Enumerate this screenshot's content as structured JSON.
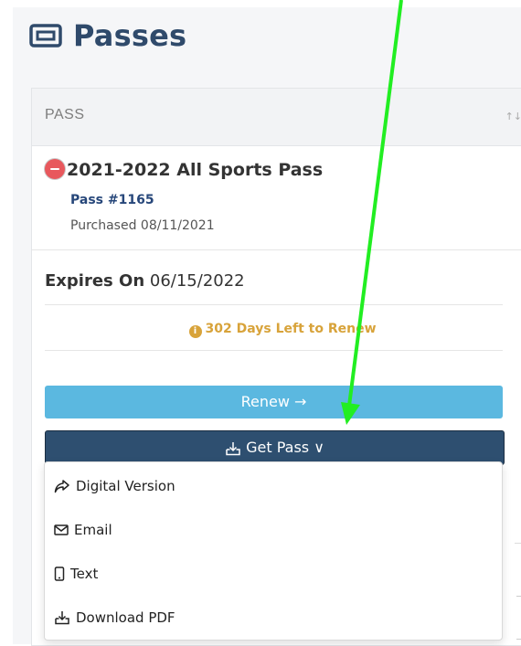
{
  "header": {
    "title": "Passes",
    "icon": "ticket-icon"
  },
  "table": {
    "column_label": "PASS",
    "sort_icon": "↑↓"
  },
  "pass": {
    "name": "2021-2022 All Sports Pass",
    "number": "Pass #1165",
    "purchased": "Purchased 08/11/2021",
    "expires_label": "Expires On",
    "expires_date": "06/15/2022",
    "days_left": "302 Days Left to Renew"
  },
  "buttons": {
    "renew": "Renew",
    "renew_arrow": "→",
    "get_pass": "Get Pass",
    "get_pass_chevron": "∨"
  },
  "dropdown": {
    "items": [
      {
        "label": "Digital Version",
        "icon": "share-icon"
      },
      {
        "label": "Email",
        "icon": "envelope-icon"
      },
      {
        "label": "Text",
        "icon": "phone-icon"
      },
      {
        "label": "Download PDF",
        "icon": "download-icon"
      }
    ]
  },
  "colors": {
    "title": "#2f4a6b",
    "pass_number": "#27477a",
    "warning": "#d8a33a",
    "renew_button": "#5bb8e0",
    "get_pass_button": "#2e4f70",
    "remove_button": "#e8585d",
    "annotation_arrow": "#22ee22"
  }
}
